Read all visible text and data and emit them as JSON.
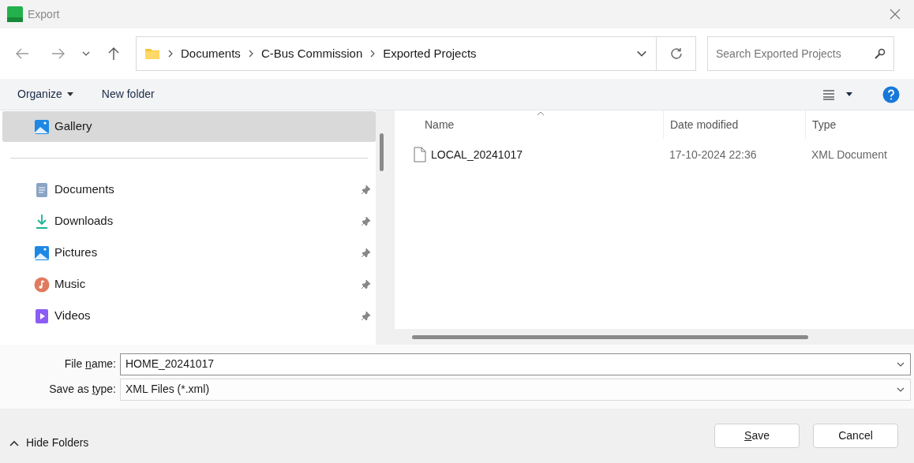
{
  "window": {
    "title": "Export"
  },
  "breadcrumb": [
    "Documents",
    "C-Bus Commission",
    "Exported Projects"
  ],
  "search": {
    "placeholder": "Search Exported Projects"
  },
  "toolbar": {
    "organize": "Organize",
    "new_folder": "New folder"
  },
  "sidebar": {
    "items": [
      {
        "label": "Gallery",
        "kind": "gallery",
        "selected": true,
        "pinned": false
      },
      {
        "label": "Documents",
        "kind": "documents",
        "selected": false,
        "pinned": true
      },
      {
        "label": "Downloads",
        "kind": "downloads",
        "selected": false,
        "pinned": true
      },
      {
        "label": "Pictures",
        "kind": "pictures",
        "selected": false,
        "pinned": true
      },
      {
        "label": "Music",
        "kind": "music",
        "selected": false,
        "pinned": true
      },
      {
        "label": "Videos",
        "kind": "videos",
        "selected": false,
        "pinned": true
      }
    ]
  },
  "table": {
    "columns": [
      "Name",
      "Date modified",
      "Type"
    ],
    "rows": [
      {
        "name": "LOCAL_20241017",
        "date": "17-10-2024 22:36",
        "type": "XML Document"
      }
    ]
  },
  "form": [
    {
      "before": "File ",
      "accelerator": "n",
      "after": "ame:",
      "value": "HOME_20241017",
      "kind": "editable"
    },
    {
      "before": "Save as ",
      "accelerator": "t",
      "after": "ype:",
      "value": "XML Files  (*.xml)",
      "kind": "select"
    }
  ],
  "footer": {
    "hide_folders": "Hide Folders",
    "save": {
      "accelerator": "S",
      "after": "ave"
    },
    "cancel": "Cancel"
  }
}
